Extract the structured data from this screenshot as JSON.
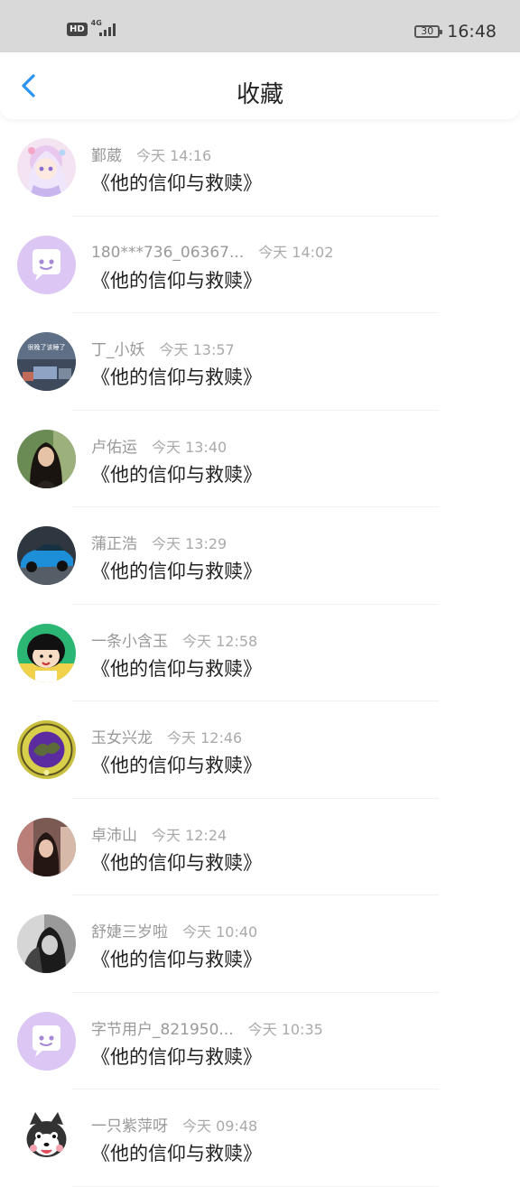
{
  "status_bar": {
    "hd": "HD",
    "network": "4G",
    "battery": "30",
    "time": "16:48"
  },
  "nav": {
    "title": "收藏",
    "back_icon": "chevron-left-icon",
    "accent_color": "#2b93f0"
  },
  "items": [
    {
      "name": "鄞葳",
      "time": "今天 14:16",
      "title": "《他的信仰与救赎》",
      "avatar": "anime-girl"
    },
    {
      "name": "180***736_06367...",
      "time": "今天 14:02",
      "title": "《他的信仰与救赎》",
      "avatar": "default-chat"
    },
    {
      "name": "丁_小妖",
      "time": "今天 13:57",
      "title": "《他的信仰与救赎》",
      "avatar": "photo-text",
      "avatar_text": "很晚了该睡了"
    },
    {
      "name": "卢佑运",
      "time": "今天 13:40",
      "title": "《他的信仰与救赎》",
      "avatar": "portrait-woman"
    },
    {
      "name": "蒲正浩",
      "time": "今天 13:29",
      "title": "《他的信仰与救赎》",
      "avatar": "blue-car"
    },
    {
      "name": "一条小含玉",
      "time": "今天 12:58",
      "title": "《他的信仰与救赎》",
      "avatar": "cartoon-girl"
    },
    {
      "name": "玉女兴龙",
      "time": "今天 12:46",
      "title": "《他的信仰与救赎》",
      "avatar": "emblem"
    },
    {
      "name": "卓沛山",
      "time": "今天 12:24",
      "title": "《他的信仰与救赎》",
      "avatar": "portrait-dark"
    },
    {
      "name": "舒婕三岁啦",
      "time": "今天 10:40",
      "title": "《他的信仰与救赎》",
      "avatar": "portrait-bw"
    },
    {
      "name": "字节用户_821950...",
      "time": "今天 10:35",
      "title": "《他的信仰与救赎》",
      "avatar": "default-chat"
    },
    {
      "name": "一只紫萍呀",
      "time": "今天 09:48",
      "title": "《他的信仰与救赎》",
      "avatar": "cartoon-dog"
    }
  ]
}
